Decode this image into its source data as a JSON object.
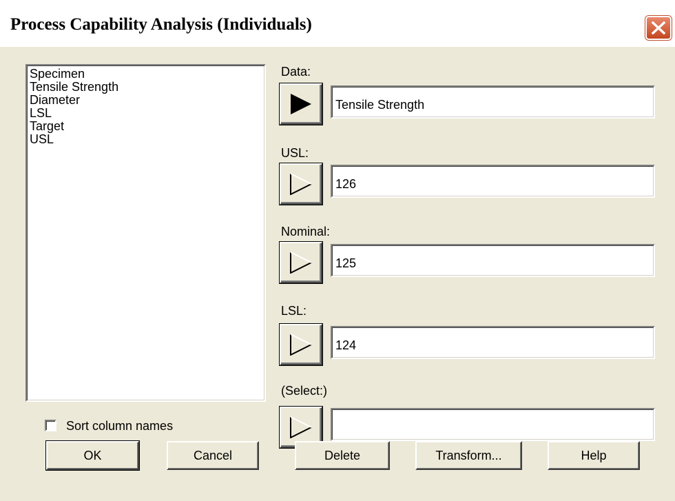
{
  "window": {
    "title": "Process Capability Analysis (Individuals)"
  },
  "column_list": {
    "items": [
      "Specimen",
      "Tensile Strength",
      "Diameter",
      "LSL",
      "Target",
      "USL"
    ]
  },
  "sort_checkbox": {
    "label": "Sort column names",
    "checked": false
  },
  "fields": {
    "data": {
      "label": "Data:",
      "value": "Tensile Strength",
      "button_filled": true
    },
    "usl": {
      "label": "USL:",
      "value": "126",
      "button_filled": false
    },
    "nominal": {
      "label": "Nominal:",
      "value": "125",
      "button_filled": false
    },
    "lsl": {
      "label": "LSL:",
      "value": "124",
      "button_filled": false
    },
    "select": {
      "label": "(Select:)",
      "value": "",
      "button_filled": false
    }
  },
  "buttons": {
    "ok": "OK",
    "cancel": "Cancel",
    "delete": "Delete",
    "transform": "Transform...",
    "help": "Help"
  },
  "icons": {
    "close": "close-icon",
    "arrow_filled": "arrow-right-filled-icon",
    "arrow_outline": "arrow-right-outline-icon"
  },
  "colors": {
    "dialog_face": "#ece9d8",
    "close_button": "#d85a35"
  }
}
